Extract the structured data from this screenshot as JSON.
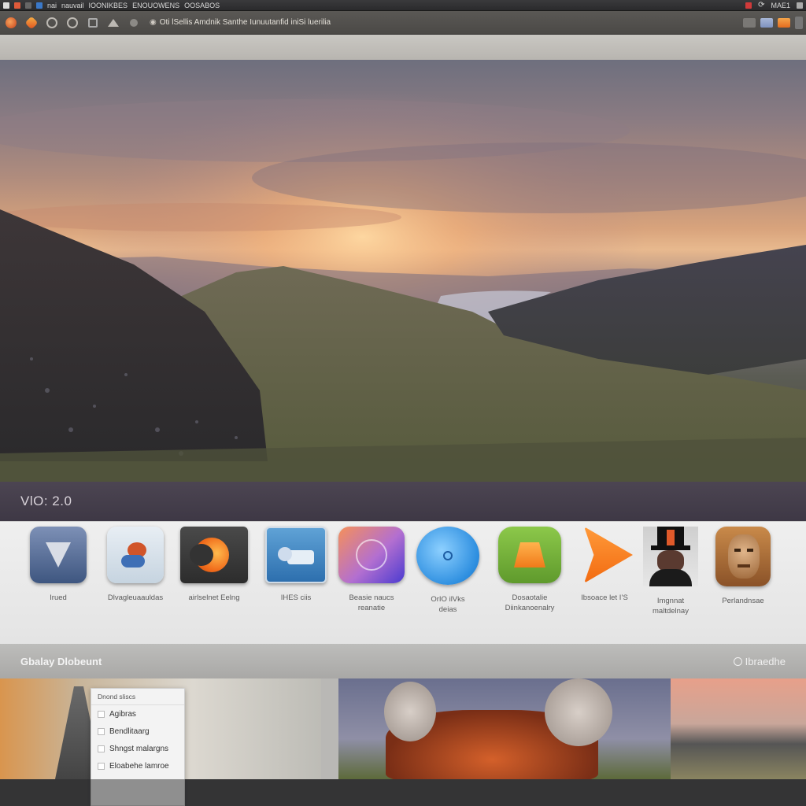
{
  "top_panel": {
    "items": [
      "nai",
      "nauvail",
      "IOONIKBES",
      "ENOUOWENS",
      "OOSABOS"
    ],
    "clock": "MAE1"
  },
  "toolbar": {
    "address": "Oti lSellis Amdnik Santhe Iunuutanfid iniSi luerilia"
  },
  "hero": {
    "caption": "VlO: 2.0"
  },
  "apps": [
    {
      "label": "Irued",
      "name": "app-irued"
    },
    {
      "label": "Dlvagleuaauldas",
      "name": "app-dlvagle"
    },
    {
      "label": "airlselnet Eelng",
      "name": "app-airlselnet"
    },
    {
      "label": "IHES ciis",
      "name": "app-ihes"
    },
    {
      "label": "Beasie naucs\nreanatie",
      "name": "app-beasie"
    },
    {
      "label": "OrIO ilVks\ndeias",
      "name": "app-orio"
    },
    {
      "label": "Dosaotalie\nDiinkanoenalry",
      "name": "app-dosaotalie"
    },
    {
      "label": "Ibsoace let I’S",
      "name": "app-ibsoace"
    },
    {
      "label": "Imgnnat\nmaltdelnay",
      "name": "app-imgnnat"
    },
    {
      "label": "Perlandnsae",
      "name": "app-perland"
    }
  ],
  "section": {
    "title": "Gbalay Dlobeunt",
    "link": "Ibraedhe"
  },
  "popup": {
    "header": "Dnond sliscs",
    "items": [
      "Agibras",
      "Bendlitaarg",
      "Shngst malargns",
      "Eloabehe lamroe"
    ]
  },
  "colors": {
    "accent": "#f07a2a",
    "toolbar": "#4b4946",
    "caption": "#4c4552"
  }
}
